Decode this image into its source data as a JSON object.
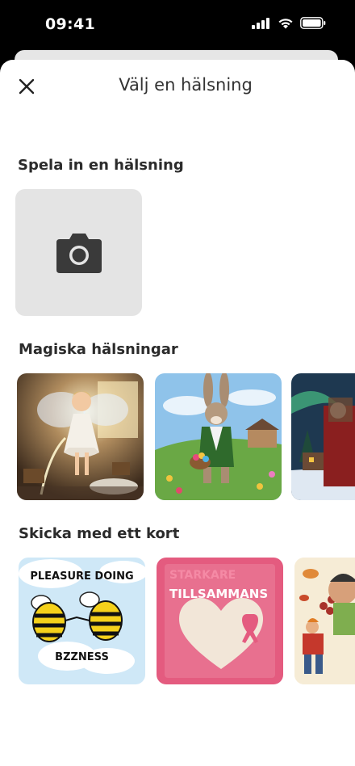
{
  "status_bar": {
    "time": "09:41"
  },
  "sheet": {
    "title": "Välj en hälsning"
  },
  "sections": {
    "record": {
      "title": "Spela in en hälsning"
    },
    "magic": {
      "title": "Magiska hälsningar"
    },
    "cards": {
      "title": "Skicka med ett kort"
    }
  },
  "cards": {
    "bees": {
      "line1": "PLEASURE DOING",
      "line2": "BZZNESS"
    },
    "heart": {
      "line1": "STARKARE",
      "line2": "TILLSAMMANS"
    }
  },
  "icons": {
    "close": "close-icon",
    "camera": "camera-icon"
  },
  "colors": {
    "sheet_bg": "#ffffff",
    "camera_tile_bg": "#e4e4e4",
    "bees_card_bg": "#cfe8f7",
    "heart_card_bg": "#e45b7f"
  }
}
